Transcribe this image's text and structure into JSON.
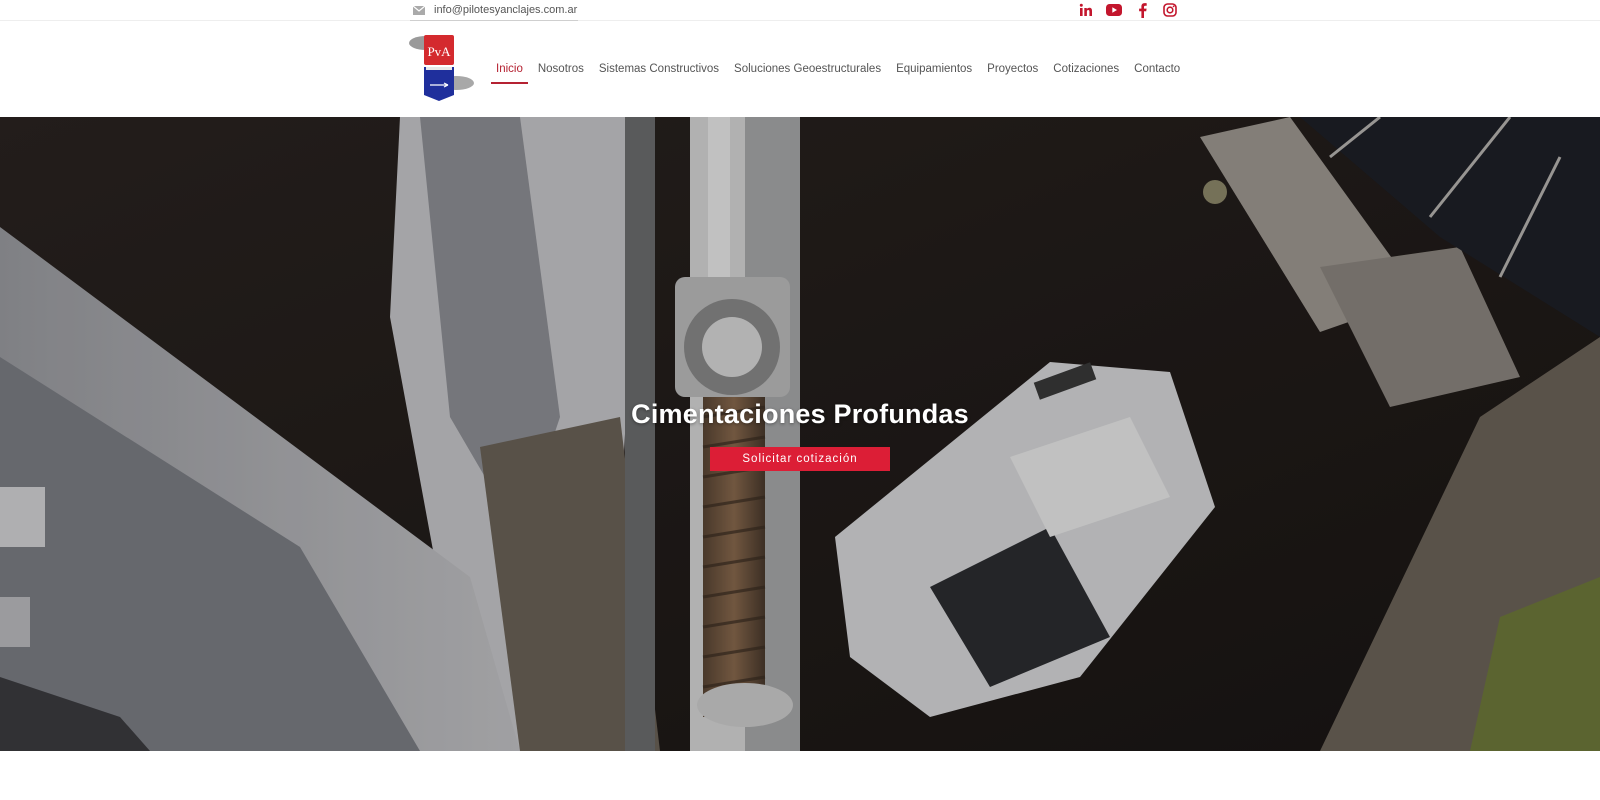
{
  "topbar": {
    "email": "info@pilotesyanclajes.com.ar",
    "email_icon": "envelope-icon",
    "socials": [
      {
        "name": "linkedin-icon",
        "label": "in"
      },
      {
        "name": "youtube-icon"
      },
      {
        "name": "facebook-icon"
      },
      {
        "name": "instagram-icon"
      }
    ],
    "social_color": "#c3162d"
  },
  "header": {
    "logo_text": "PvA",
    "nav": [
      {
        "label": "Inicio",
        "active": true
      },
      {
        "label": "Nosotros"
      },
      {
        "label": "Sistemas Constructivos"
      },
      {
        "label": "Soluciones Geoestructurales"
      },
      {
        "label": "Equipamientos"
      },
      {
        "label": "Proyectos"
      },
      {
        "label": "Cotizaciones"
      },
      {
        "label": "Contacto"
      }
    ],
    "active_color": "#b52232"
  },
  "hero": {
    "title": "Cimentaciones Profundas",
    "button_label": "Solicitar cotización",
    "button_color": "#dc1e36"
  }
}
